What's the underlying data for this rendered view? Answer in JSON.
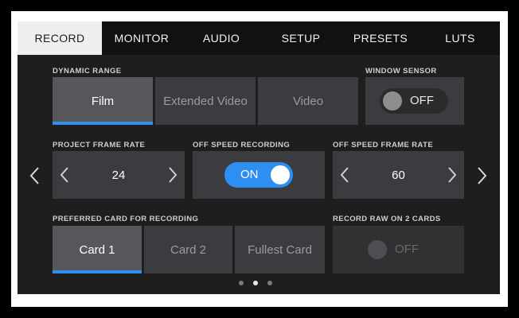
{
  "tabs": [
    "RECORD",
    "MONITOR",
    "AUDIO",
    "SETUP",
    "PRESETS",
    "LUTS"
  ],
  "dynamic_range": {
    "label": "DYNAMIC RANGE",
    "options": [
      "Film",
      "Extended Video",
      "Video"
    ],
    "selected": "Film"
  },
  "window_sensor": {
    "label": "WINDOW SENSOR",
    "state": "OFF"
  },
  "project_frame_rate": {
    "label": "PROJECT FRAME RATE",
    "value": "24"
  },
  "off_speed_recording": {
    "label": "OFF SPEED RECORDING",
    "state": "ON"
  },
  "off_speed_frame_rate": {
    "label": "OFF SPEED FRAME RATE",
    "value": "60"
  },
  "preferred_card": {
    "label": "PREFERRED CARD FOR RECORDING",
    "options": [
      "Card 1",
      "Card 2",
      "Fullest Card"
    ],
    "selected": "Card 1"
  },
  "record_raw_2_cards": {
    "label": "RECORD RAW ON 2 CARDS",
    "state": "OFF"
  },
  "pagination": {
    "current": 2,
    "total": 3
  },
  "colors": {
    "accent": "#2d8ff0",
    "tile": "#3b3c3f",
    "tile_selected": "#55575b"
  }
}
